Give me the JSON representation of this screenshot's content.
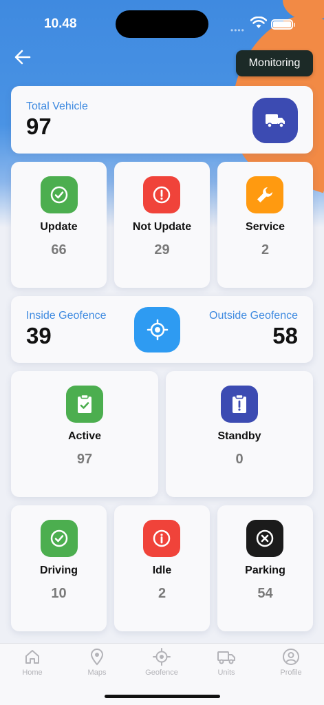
{
  "status_bar": {
    "time": "10.48"
  },
  "header": {
    "monitoring_label": "Monitoring"
  },
  "total": {
    "label": "Total Vehicle",
    "value": "97"
  },
  "update_tiles": [
    {
      "label": "Update",
      "value": "66",
      "color": "#4cae4f",
      "icon": "check-circle-icon"
    },
    {
      "label": "Not Update",
      "value": "29",
      "color": "#f0433a",
      "icon": "alert-circle-icon"
    },
    {
      "label": "Service",
      "value": "2",
      "color": "#ff9a10",
      "icon": "wrench-icon"
    }
  ],
  "geofence": {
    "inside_label": "Inside Geofence",
    "inside_value": "39",
    "outside_label": "Outside Geofence",
    "outside_value": "58"
  },
  "status_tiles": [
    {
      "label": "Active",
      "value": "97",
      "color": "#4cae4f",
      "icon": "clipboard-check-icon"
    },
    {
      "label": "Standby",
      "value": "0",
      "color": "#3c4bb2",
      "icon": "clipboard-alert-icon"
    }
  ],
  "motion_tiles": [
    {
      "label": "Driving",
      "value": "10",
      "color": "#4cae4f",
      "icon": "check-circle-icon"
    },
    {
      "label": "Idle",
      "value": "2",
      "color": "#f0433a",
      "icon": "info-circle-icon"
    },
    {
      "label": "Parking",
      "value": "54",
      "color": "#1b1b1b",
      "icon": "x-circle-icon"
    }
  ],
  "tabbar": {
    "items": [
      {
        "label": "Home",
        "icon": "home-icon"
      },
      {
        "label": "Maps",
        "icon": "map-pin-icon"
      },
      {
        "label": "Geofence",
        "icon": "crosshair-icon"
      },
      {
        "label": "Units",
        "icon": "truck-icon"
      },
      {
        "label": "Profile",
        "icon": "user-circle-icon"
      }
    ]
  }
}
